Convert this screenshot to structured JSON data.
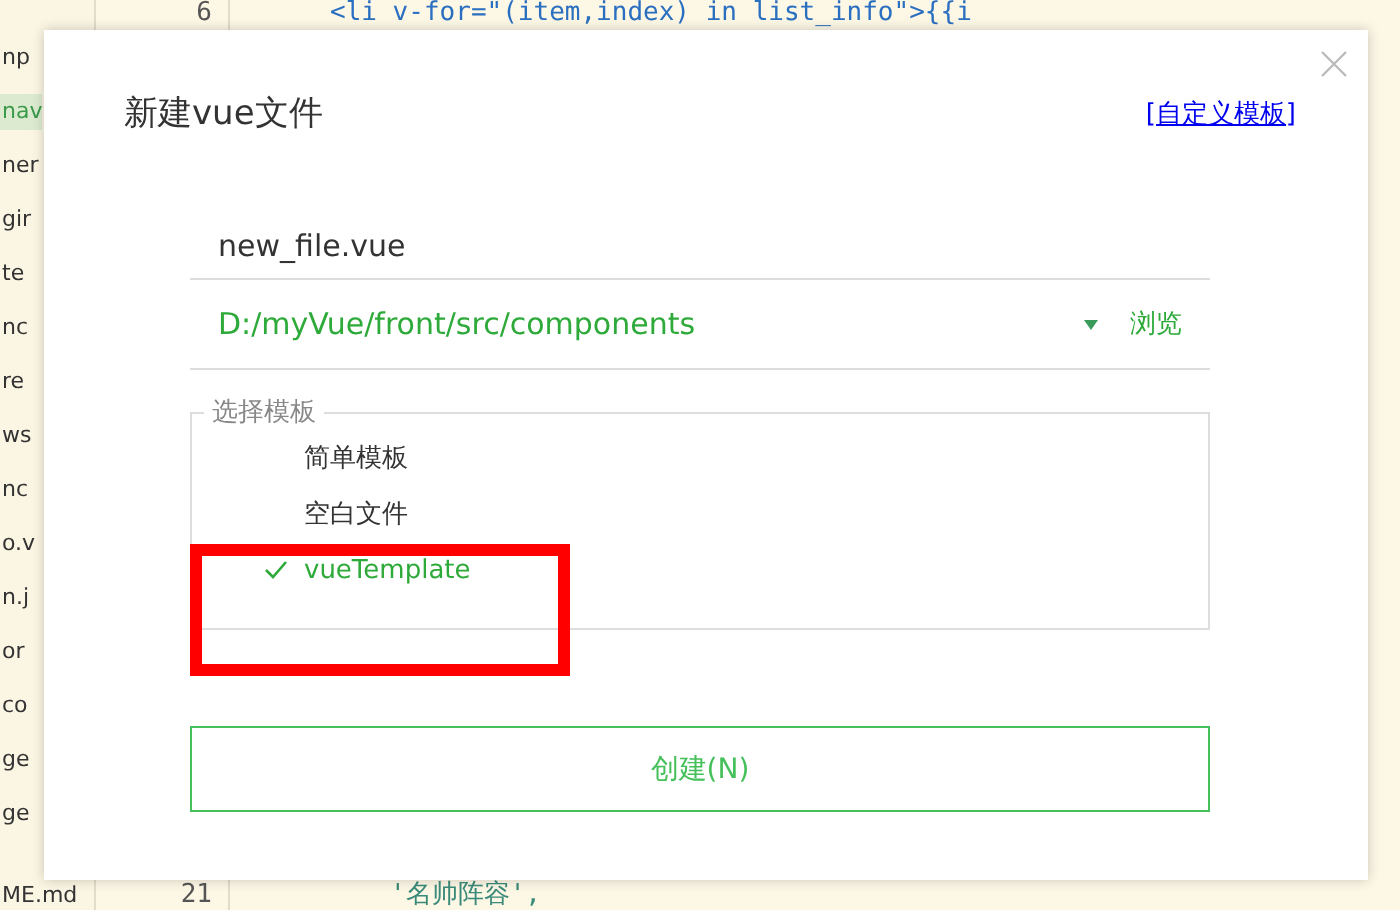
{
  "editor": {
    "sidebar": [
      {
        "label": "np",
        "selected": false
      },
      {
        "label": "nav",
        "selected": true
      },
      {
        "label": "ner",
        "selected": false
      },
      {
        "label": "gir",
        "selected": false
      },
      {
        "label": "te",
        "selected": false
      },
      {
        "label": "nc",
        "selected": false
      },
      {
        "label": "re",
        "selected": false
      },
      {
        "label": "ws",
        "selected": false
      },
      {
        "label": "nc",
        "selected": false
      },
      {
        "label": "o.v",
        "selected": false
      },
      {
        "label": "n.j",
        "selected": false
      },
      {
        "label": "or",
        "selected": false
      },
      {
        "label": "co",
        "selected": false
      },
      {
        "label": "ge",
        "selected": false
      },
      {
        "label": "ge",
        "selected": false
      },
      {
        "label": "ME.md",
        "selected": false
      }
    ],
    "lines": [
      {
        "number": "6",
        "code": "<li v-for=\"(item,index) in list_info\">{{i"
      },
      {
        "number": "21",
        "code": "'名帅阵容',"
      }
    ]
  },
  "dialog": {
    "title": "新建vue文件",
    "custom_template_link": "[自定义模板]",
    "file_name": "new_file.vue",
    "path": "D:/myVue/front/src/components",
    "browse": "浏览",
    "template_group": {
      "legend": "选择模板",
      "items": [
        {
          "label": "简单模板",
          "selected": false
        },
        {
          "label": "空白文件",
          "selected": false
        },
        {
          "label": "vueTemplate",
          "selected": true
        }
      ]
    },
    "create_button": "创建(N)"
  }
}
